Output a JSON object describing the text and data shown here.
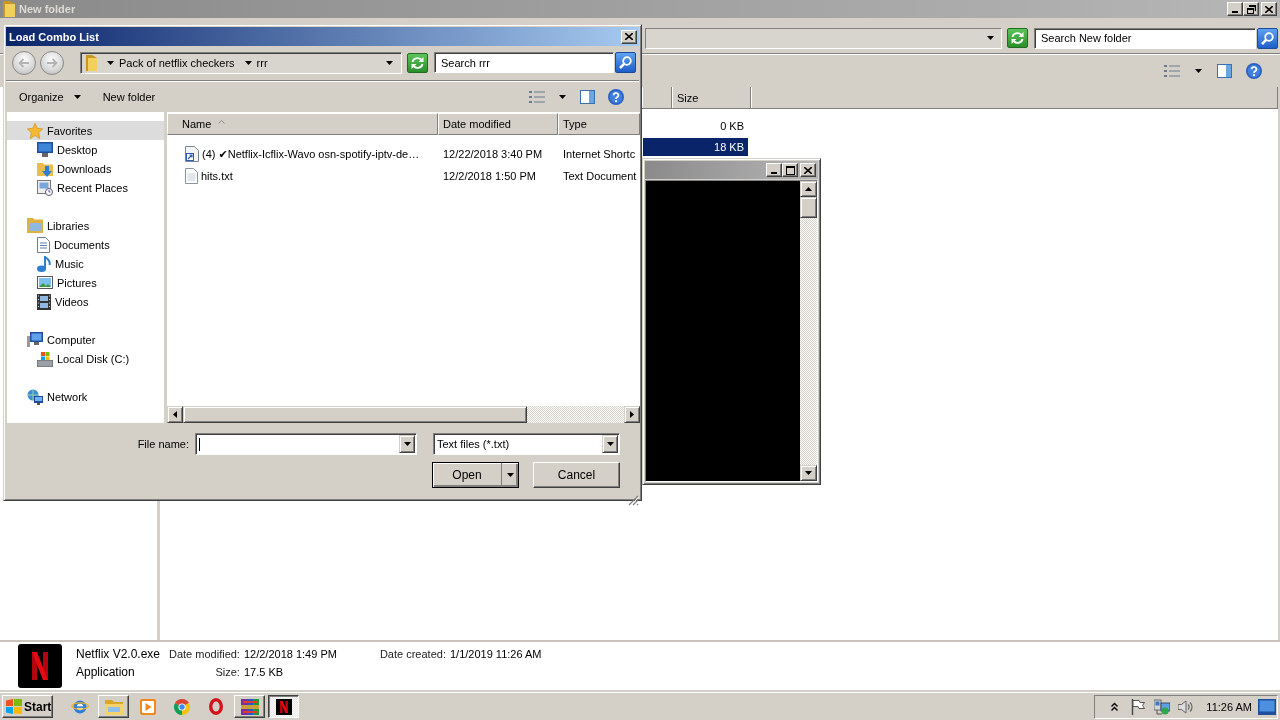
{
  "explorer": {
    "title": "New folder",
    "search": {
      "placeholder": "Search New folder"
    },
    "columns": [
      {
        "label": "Size"
      }
    ],
    "rows": [
      {
        "size": "0 KB",
        "selected": false
      },
      {
        "size": "18 KB",
        "selected": true
      }
    ],
    "details": {
      "name": "Netflix V2.0.exe",
      "type": "Application",
      "field_groups": [
        {
          "fields": [
            {
              "label": "Date modified:",
              "value": "12/2/2018 1:49 PM"
            },
            {
              "label": "Size:",
              "value": "17.5 KB"
            }
          ]
        },
        {
          "fields": [
            {
              "label": "Date created:",
              "value": "1/1/2019 11:26 AM"
            }
          ]
        }
      ]
    }
  },
  "dialog": {
    "title": "Load Combo List",
    "history": [
      {
        "disabled": true
      },
      {
        "disabled": true
      }
    ],
    "breadcrumb": [
      "Pack of netflix checkers",
      "rrr"
    ],
    "search": {
      "placeholder": "Search rrr"
    },
    "toolbar": [
      {
        "label": "Organize",
        "kind": "menu"
      },
      {
        "label": "New folder",
        "kind": "button"
      }
    ],
    "nav": [
      {
        "label": "Favorites",
        "kind": "star",
        "selected": true,
        "children": [
          {
            "label": "Desktop",
            "kind": "desktop",
            "selected": false
          },
          {
            "label": "Downloads",
            "kind": "downloads",
            "selected": false
          },
          {
            "label": "Recent Places",
            "kind": "recent",
            "selected": false
          }
        ]
      },
      {
        "label": "Libraries",
        "kind": "library",
        "selected": false,
        "children": [
          {
            "label": "Documents",
            "kind": "document",
            "selected": false
          },
          {
            "label": "Music",
            "kind": "music",
            "selected": false
          },
          {
            "label": "Pictures",
            "kind": "picture",
            "selected": false
          },
          {
            "label": "Videos",
            "kind": "video",
            "selected": false
          }
        ]
      },
      {
        "label": "Computer",
        "kind": "computer",
        "selected": false,
        "children": [
          {
            "label": "Local Disk (C:)",
            "kind": "disk",
            "selected": false
          }
        ]
      },
      {
        "label": "Network",
        "kind": "network",
        "selected": false
      }
    ],
    "columns": [
      {
        "label": "Name",
        "sorted": true
      },
      {
        "label": "Date modified",
        "sorted": false
      },
      {
        "label": "Type",
        "sorted": false
      }
    ],
    "files": [
      {
        "name": "(4) ✔Netflix-Icflix-Wavo osn-spotify-iptv-de…",
        "date": "12/22/2018 3:40 PM",
        "type": "Internet Shortc",
        "kind": "shortcut",
        "selected": false
      },
      {
        "name": "hits.txt",
        "date": "12/2/2018 1:50 PM",
        "type": "Text Document",
        "kind": "text",
        "selected": false
      }
    ],
    "file_name": {
      "label": "File name:",
      "focused": true
    },
    "file_type": {
      "value": "Text files (*.txt)"
    },
    "buttons": [
      {
        "label": "Open",
        "kind": "split"
      },
      {
        "label": "Cancel",
        "kind": "plain"
      }
    ]
  },
  "taskbar": {
    "start": "Start",
    "apps": [
      {
        "kind": "globe",
        "running": false,
        "selected": false
      },
      {
        "kind": "folder",
        "running": true,
        "selected": false
      },
      {
        "kind": "play",
        "running": false,
        "selected": false
      },
      {
        "kind": "wheel",
        "running": false,
        "selected": false
      },
      {
        "kind": "ring",
        "running": false,
        "selected": false
      },
      {
        "kind": "blocks",
        "running": true,
        "selected": false
      },
      {
        "kind": "tile",
        "running": true,
        "selected": true
      }
    ],
    "clock": "11:26 AM"
  }
}
